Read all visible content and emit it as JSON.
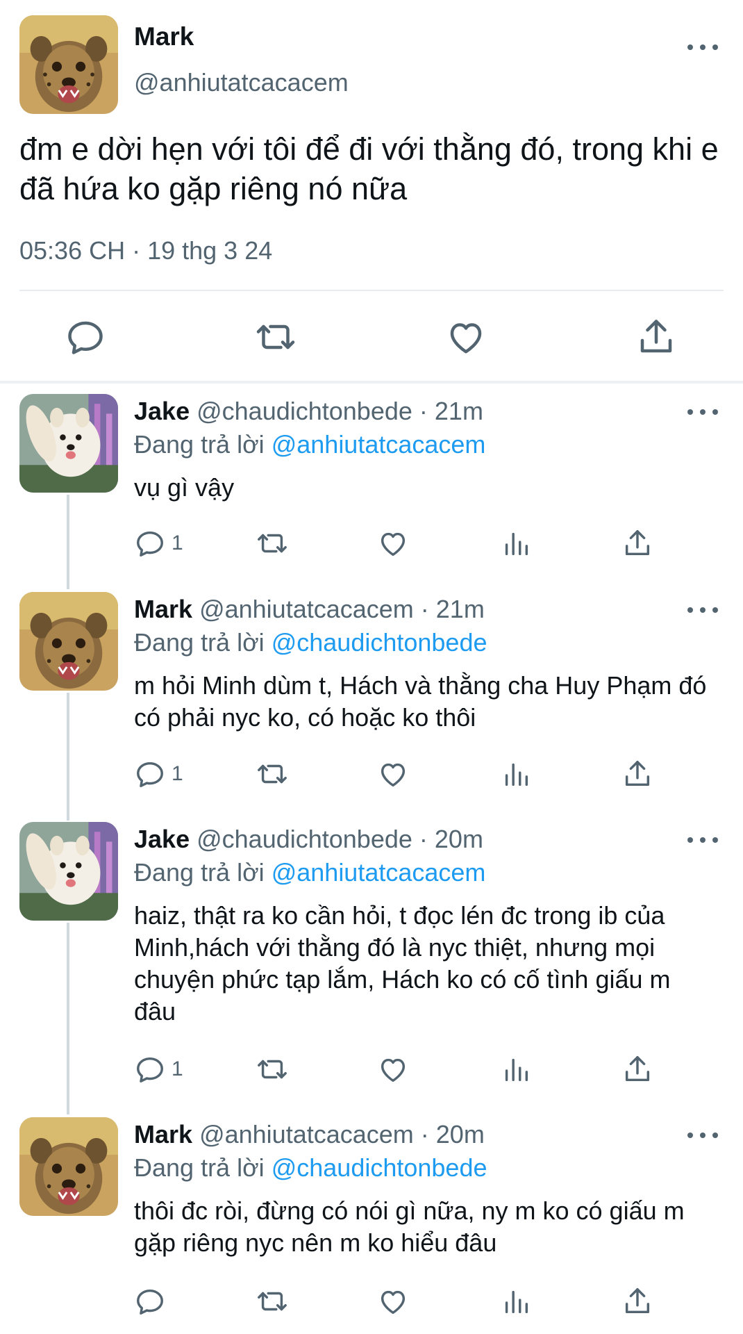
{
  "main_tweet": {
    "name": "Mark",
    "handle": "@anhiutatcacacem",
    "text": "đm e dời hẹn với tôi để đi với thằng đó, trong khi e đã hứa ko gặp riêng nó nữa",
    "timestamp": "05:36 CH · 19 thg 3 24",
    "actions": [
      "reply-icon",
      "retweet-icon",
      "like-icon",
      "share-icon"
    ]
  },
  "replies": [
    {
      "name": "Jake",
      "handle": "@chaudichtonbede",
      "time": "· 21m",
      "replying_label": "Đang trả lời",
      "replying_to": "@anhiutatcacacem",
      "text": "vụ gì vậy",
      "reply_count": "1"
    },
    {
      "name": "Mark",
      "handle": "@anhiutatcacacem",
      "time": "· 21m",
      "replying_label": "Đang trả lời",
      "replying_to": "@chaudichtonbede",
      "text": "m hỏi Minh dùm t, Hách và thằng cha Huy Phạm đó có phải nyc ko, có hoặc ko thôi",
      "reply_count": "1"
    },
    {
      "name": "Jake",
      "handle": "@chaudichtonbede",
      "time": "· 20m",
      "replying_label": "Đang trả lời",
      "replying_to": "@anhiutatcacacem",
      "text": "haiz, thật ra ko cần hỏi, t đọc lén đc trong ib của Minh,hách với thằng đó là nyc thiệt, nhưng mọi chuyện phức tạp lắm, Hách ko có cố tình giấu m đâu",
      "reply_count": "1"
    },
    {
      "name": "Mark",
      "handle": "@anhiutatcacacem",
      "time": "· 20m",
      "replying_label": "Đang trả lời",
      "replying_to": "@chaudichtonbede",
      "text": "thôi đc ròi, đừng có nói gì nữa, ny m ko có giấu m gặp riêng nyc nên m ko hiểu đâu",
      "reply_count": ""
    }
  ],
  "colors": {
    "text": "#0f1419",
    "secondary": "#536471",
    "link": "#1d9bf0",
    "thread_line": "#cfd9de"
  }
}
